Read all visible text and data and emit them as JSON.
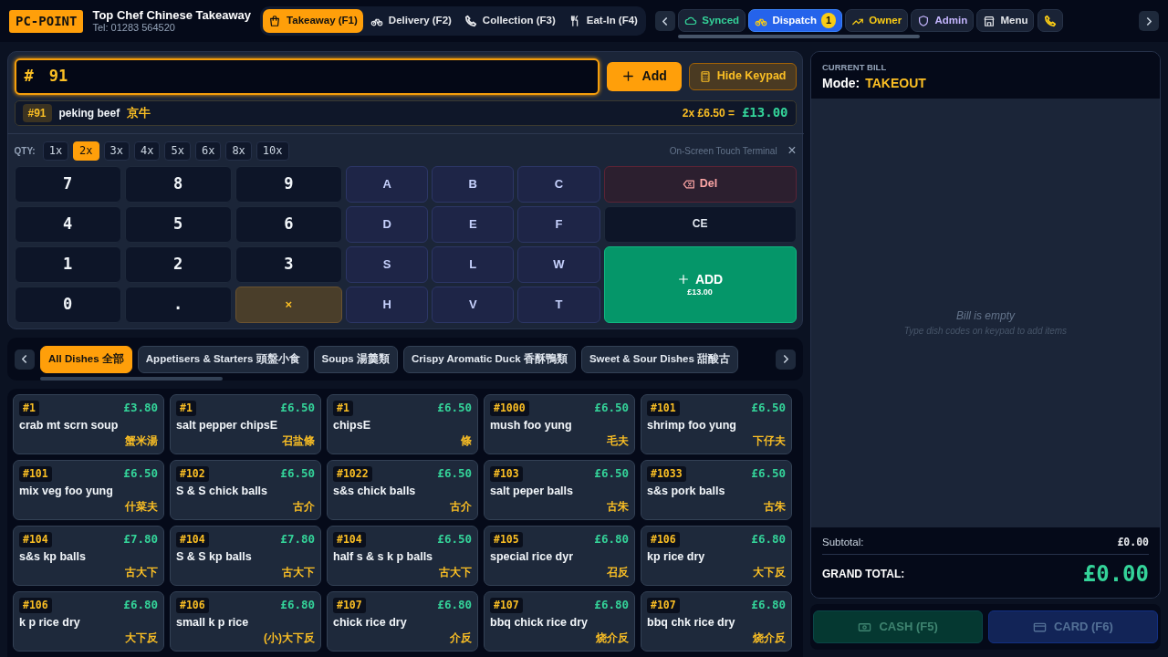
{
  "header": {
    "logo": "PC-POINT",
    "shop_name": "Top Chef Chinese Takeaway",
    "phone": "Tel: 01283 564520"
  },
  "mode_tabs": [
    {
      "label": "Takeaway (F1)",
      "selected": true
    },
    {
      "label": "Delivery (F2)",
      "selected": false
    },
    {
      "label": "Collection (F3)",
      "selected": false
    },
    {
      "label": "Eat-In (F4)",
      "selected": false
    }
  ],
  "toolbar_chips": [
    {
      "label": "Synced",
      "color": "#34d399",
      "highlighted": false
    },
    {
      "label": "Dispatch",
      "color": "#ffffff",
      "highlighted": true,
      "badge": "1"
    },
    {
      "label": "Owner",
      "color": "#facc15",
      "highlighted": false
    },
    {
      "label": "Admin",
      "color": "#c4b5fd",
      "highlighted": false
    },
    {
      "label": "Menu",
      "color": "#e5e7eb",
      "highlighted": false
    },
    {
      "color": "#facc15",
      "highlighted": false
    }
  ],
  "entry": {
    "prefix": "#",
    "value": "91",
    "add_button": "Add",
    "keypad_button": "Hide Keypad"
  },
  "preview": {
    "code": "#91",
    "name": "peking beef",
    "chinese": "京牛",
    "calc": "2x £6.50 =",
    "total": "£13.00"
  },
  "qty": {
    "label": "QTY:",
    "options": [
      {
        "label": "1x",
        "selected": false
      },
      {
        "label": "2x",
        "selected": true
      },
      {
        "label": "3x",
        "selected": false
      },
      {
        "label": "4x",
        "selected": false
      },
      {
        "label": "5x",
        "selected": false
      },
      {
        "label": "6x",
        "selected": false
      },
      {
        "label": "8x",
        "selected": false
      },
      {
        "label": "10x",
        "selected": false
      }
    ],
    "terminal_label": "On-Screen Touch Terminal",
    "close": "×"
  },
  "keypad": [
    {
      "kind": "digit",
      "label": "7"
    },
    {
      "kind": "digit",
      "label": "8"
    },
    {
      "kind": "digit",
      "label": "9"
    },
    {
      "kind": "letter",
      "label": "A"
    },
    {
      "kind": "letter",
      "label": "B"
    },
    {
      "kind": "letter",
      "label": "C"
    },
    {
      "kind": "del",
      "label": "Del"
    },
    {
      "kind": "digit",
      "label": "4"
    },
    {
      "kind": "digit",
      "label": "5"
    },
    {
      "kind": "digit",
      "label": "6"
    },
    {
      "kind": "letter",
      "label": "D"
    },
    {
      "kind": "letter",
      "label": "E"
    },
    {
      "kind": "letter",
      "label": "F"
    },
    {
      "kind": "ce",
      "label": "CE"
    },
    {
      "kind": "digit",
      "label": "1"
    },
    {
      "kind": "digit",
      "label": "2"
    },
    {
      "kind": "digit",
      "label": "3"
    },
    {
      "kind": "letter",
      "label": "S"
    },
    {
      "kind": "letter",
      "label": "L"
    },
    {
      "kind": "letter",
      "label": "W"
    },
    {
      "kind": "add",
      "label": "ADD",
      "sub": "£13.00"
    },
    {
      "kind": "digit",
      "label": "0"
    },
    {
      "kind": "digit",
      "label": "."
    },
    {
      "kind": "times",
      "label": "×"
    },
    {
      "kind": "letter",
      "label": "H"
    },
    {
      "kind": "letter",
      "label": "V"
    },
    {
      "kind": "letter",
      "label": "T"
    }
  ],
  "categories": [
    {
      "label": "All Dishes 全部",
      "selected": true
    },
    {
      "label": "Appetisers & Starters 頭盤小食",
      "selected": false
    },
    {
      "label": "Soups 湯羹類",
      "selected": false
    },
    {
      "label": "Crispy Aromatic Duck 香酥鴨類",
      "selected": false
    },
    {
      "label": "Sweet & Sour Dishes 甜酸古",
      "selected": false
    }
  ],
  "dishes": [
    {
      "code": "#1",
      "price": "£3.80",
      "name": "crab mt scrn soup",
      "chinese": "蟹米湯"
    },
    {
      "code": "#1",
      "price": "£6.50",
      "name": "salt pepper chipsE",
      "chinese": "召盐條"
    },
    {
      "code": "#1",
      "price": "£6.50",
      "name": "chipsE",
      "chinese": "條"
    },
    {
      "code": "#1000",
      "price": "£6.50",
      "name": "mush foo yung",
      "chinese": "毛夫"
    },
    {
      "code": "#101",
      "price": "£6.50",
      "name": "shrimp foo yung",
      "chinese": "下仔夫"
    },
    {
      "code": "#101",
      "price": "£6.50",
      "name": "mix veg foo yung",
      "chinese": "什菜夫"
    },
    {
      "code": "#102",
      "price": "£6.50",
      "name": "S & S chick balls",
      "chinese": "古介"
    },
    {
      "code": "#1022",
      "price": "£6.50",
      "name": "s&s chick balls",
      "chinese": "古介"
    },
    {
      "code": "#103",
      "price": "£6.50",
      "name": "salt peper balls",
      "chinese": "古朱"
    },
    {
      "code": "#1033",
      "price": "£6.50",
      "name": "s&s pork balls",
      "chinese": "古朱"
    },
    {
      "code": "#104",
      "price": "£7.80",
      "name": "s&s kp balls",
      "chinese": "古大下"
    },
    {
      "code": "#104",
      "price": "£7.80",
      "name": "S & S kp balls",
      "chinese": "古大下"
    },
    {
      "code": "#104",
      "price": "£6.50",
      "name": "half s & s k p balls",
      "chinese": "古大下"
    },
    {
      "code": "#105",
      "price": "£6.80",
      "name": "special rice dyr",
      "chinese": "召反"
    },
    {
      "code": "#106",
      "price": "£6.80",
      "name": "kp rice dry",
      "chinese": "大下反"
    },
    {
      "code": "#106",
      "price": "£6.80",
      "name": "k p rice dry",
      "chinese": "大下反"
    },
    {
      "code": "#106",
      "price": "£6.80",
      "name": "small k p rice",
      "chinese": "(小)大下反"
    },
    {
      "code": "#107",
      "price": "£6.80",
      "name": "chick rice dry",
      "chinese": "介反"
    },
    {
      "code": "#107",
      "price": "£6.80",
      "name": "bbq chick rice dry",
      "chinese": "烧介反"
    },
    {
      "code": "#107",
      "price": "£6.80",
      "name": "bbq chk rice dry",
      "chinese": "烧介反"
    }
  ],
  "bill": {
    "heading": "CURRENT BILL",
    "mode_label": "Mode:",
    "mode": "TAKEOUT",
    "empty_title": "Bill is empty",
    "empty_hint": "Type dish codes on keypad to add items",
    "subtotal_label": "Subtotal:",
    "subtotal": "£0.00",
    "grand_label": "GRAND TOTAL:",
    "grand": "£0.00"
  },
  "payment_buttons": [
    {
      "label": "CASH (F5)",
      "kind": "cash",
      "disabled": true
    },
    {
      "label": "CARD (F6)",
      "kind": "card",
      "disabled": true
    }
  ]
}
